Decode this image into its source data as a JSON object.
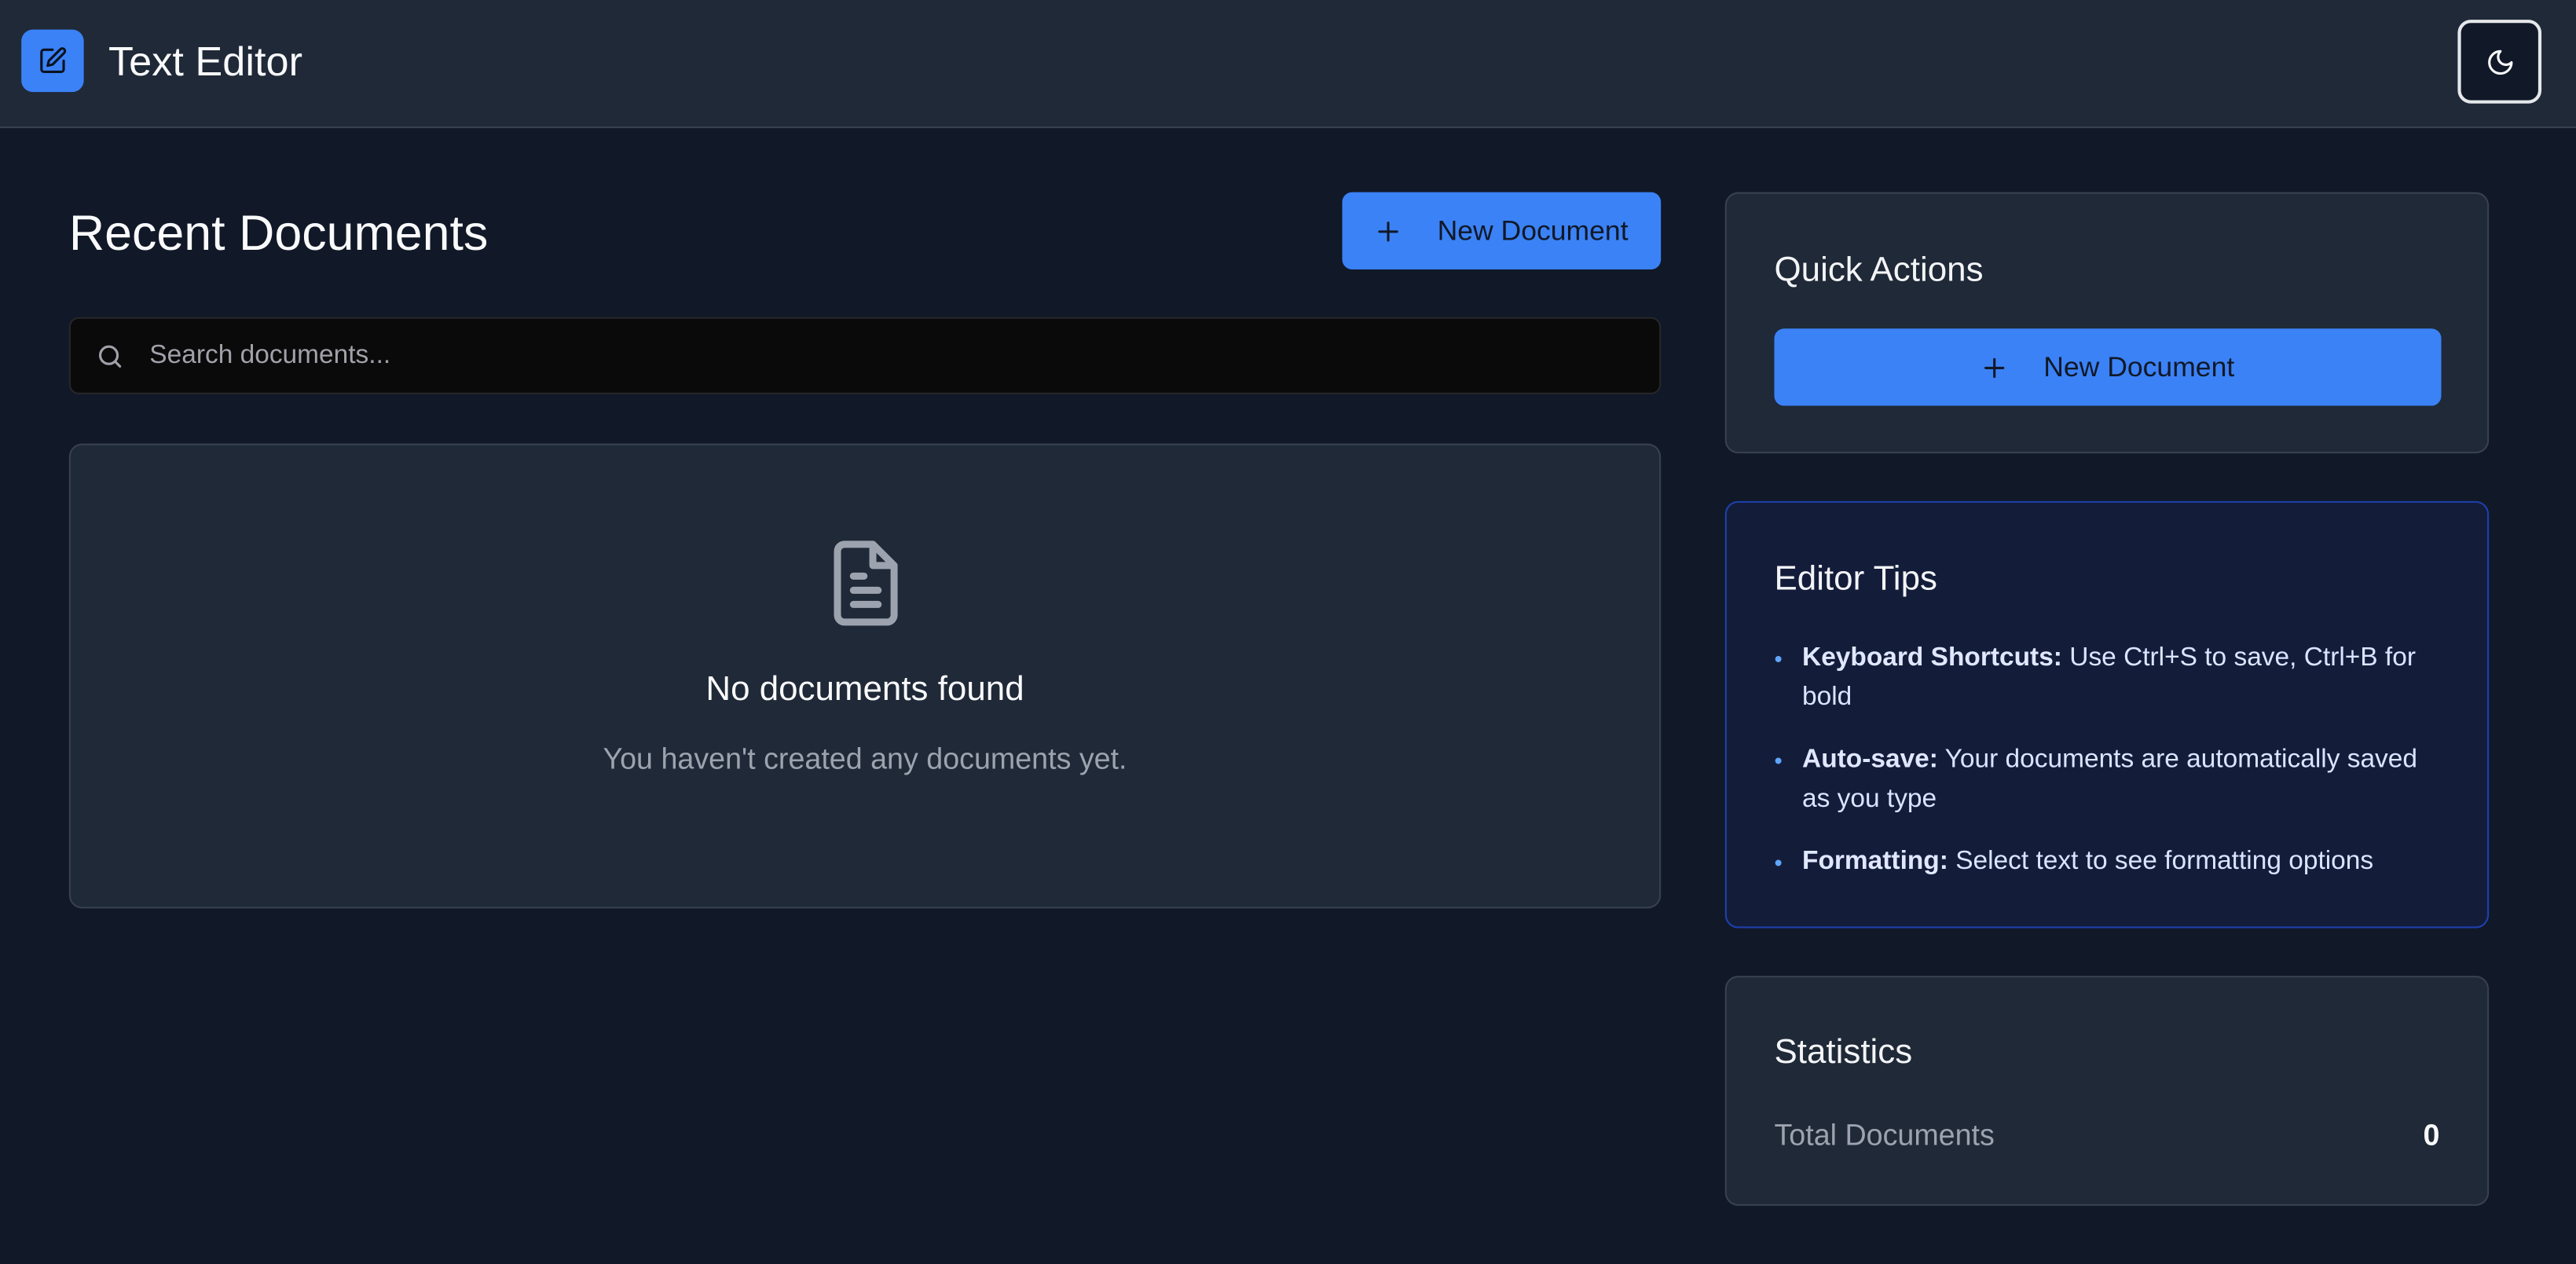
{
  "header": {
    "app_title": "Text Editor",
    "logo_icon": "edit-icon",
    "theme_toggle_icon": "moon-icon"
  },
  "documents": {
    "title": "Recent Documents",
    "new_document_label": "New Document",
    "search": {
      "placeholder": "Search documents...",
      "value": ""
    },
    "empty_state": {
      "icon": "document-icon",
      "title": "No documents found",
      "subtitle": "You haven't created any documents yet."
    }
  },
  "quick_actions": {
    "title": "Quick Actions",
    "new_document_label": "New Document"
  },
  "tips": {
    "title": "Editor Tips",
    "items": [
      {
        "label": "Keyboard Shortcuts:",
        "text": "Use Ctrl+S to save, Ctrl+B for bold"
      },
      {
        "label": "Auto-save:",
        "text": "Your documents are automatically saved as you type"
      },
      {
        "label": "Formatting:",
        "text": "Select text to see formatting options"
      }
    ]
  },
  "statistics": {
    "title": "Statistics",
    "total_documents_label": "Total Documents",
    "total_documents_value": "0"
  },
  "colors": {
    "accent": "#3b82f6",
    "background": "#111827",
    "surface": "#1f2937",
    "tips_surface": "#131d3a"
  }
}
